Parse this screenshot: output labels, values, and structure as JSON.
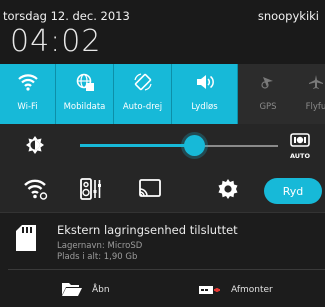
{
  "status": {
    "date": "torsdag 12. dec. 2013",
    "user": "snoopykiki",
    "time": "04:02"
  },
  "quick_settings": [
    {
      "label": "Wi-Fi",
      "icon": "wifi-icon",
      "active": true
    },
    {
      "label": "Mobildata",
      "icon": "globe-icon",
      "active": true
    },
    {
      "label": "Auto-drej",
      "icon": "rotate-icon",
      "active": true
    },
    {
      "label": "Lydløs",
      "icon": "speaker-icon",
      "active": true
    },
    {
      "label": "GPS",
      "icon": "gps-icon",
      "active": false
    },
    {
      "label": "Flyfu",
      "icon": "airplane-icon",
      "active": false
    }
  ],
  "brightness": {
    "level": 0.63,
    "auto_label": "AUTO"
  },
  "tools": {
    "clear_label": "Ryd"
  },
  "notification": {
    "title": "Ekstern lagringsenhed tilsluttet",
    "line1": "Lagernavn: MicroSD",
    "line2": "Plads i alt: 1,90 Gb",
    "actions": {
      "open": "Åbn",
      "unmount": "Afmonter"
    }
  },
  "colors": {
    "accent": "#17b9d8",
    "background": "#2b2b2b",
    "header": "#1a1a1a"
  }
}
